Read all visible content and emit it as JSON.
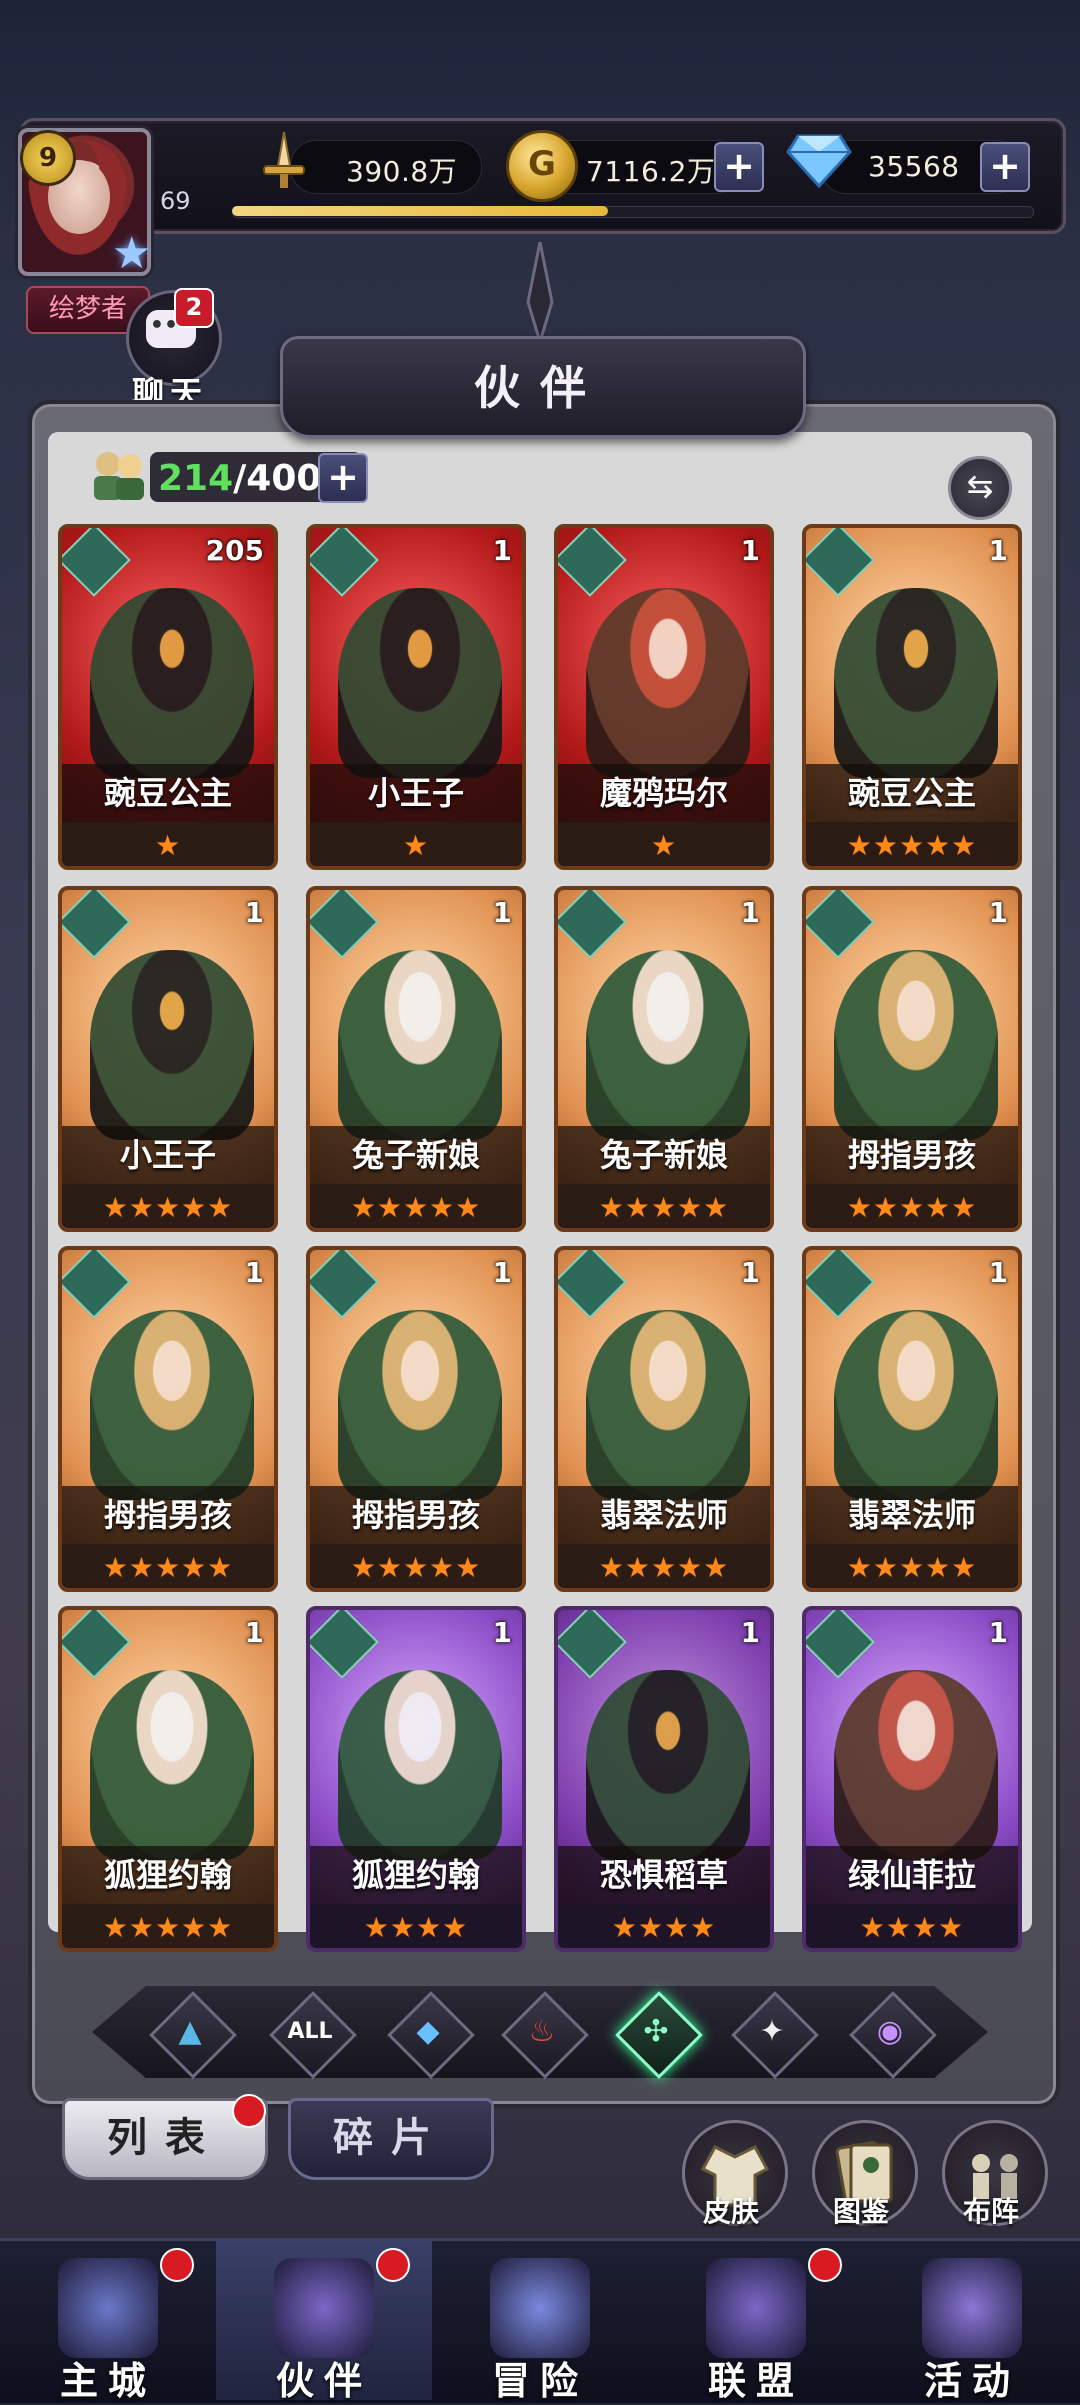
{
  "player": {
    "level": "9",
    "xp_number": "69",
    "xp_progress": 0.47,
    "title_tag": "绘梦者"
  },
  "resources": {
    "power": "390.8万",
    "gold": "7116.2万",
    "gems": "35568",
    "plus": "+"
  },
  "chat": {
    "label": "聊天",
    "badge": "2"
  },
  "page_title": "伙伴",
  "capacity": {
    "current": "214",
    "max": "/400",
    "plus": "+"
  },
  "cards": [
    {
      "name": "豌豆公主",
      "count": "205",
      "stars": "★",
      "style": "red",
      "art": "dark"
    },
    {
      "name": "小王子",
      "count": "1",
      "stars": "★",
      "style": "red",
      "art": "dark"
    },
    {
      "name": "魔鸦玛尔",
      "count": "1",
      "stars": "★",
      "style": "red",
      "art": "ginger"
    },
    {
      "name": "豌豆公主",
      "count": "1",
      "stars": "★★★★★",
      "style": "orange",
      "art": "dark"
    },
    {
      "name": "小王子",
      "count": "1",
      "stars": "★★★★★",
      "style": "orange",
      "art": "dark"
    },
    {
      "name": "兔子新娘",
      "count": "1",
      "stars": "★★★★★",
      "style": "orange",
      "art": "white"
    },
    {
      "name": "兔子新娘",
      "count": "1",
      "stars": "★★★★★",
      "style": "orange",
      "art": "white"
    },
    {
      "name": "拇指男孩",
      "count": "1",
      "stars": "★★★★★",
      "style": "orange",
      "art": "blond"
    },
    {
      "name": "拇指男孩",
      "count": "1",
      "stars": "★★★★★",
      "style": "orange",
      "art": "blond"
    },
    {
      "name": "拇指男孩",
      "count": "1",
      "stars": "★★★★★",
      "style": "orange",
      "art": "blond"
    },
    {
      "name": "翡翠法师",
      "count": "1",
      "stars": "★★★★★",
      "style": "orange",
      "art": "blond"
    },
    {
      "name": "翡翠法师",
      "count": "1",
      "stars": "★★★★★",
      "style": "orange",
      "art": "blond"
    },
    {
      "name": "狐狸约翰",
      "count": "1",
      "stars": "★★★★★",
      "style": "orange",
      "art": "white"
    },
    {
      "name": "狐狸约翰",
      "count": "1",
      "stars": "★★★★",
      "style": "purple",
      "art": "white"
    },
    {
      "name": "恐惧稻草",
      "count": "1",
      "stars": "★★★★",
      "style": "purple2",
      "art": "dark"
    },
    {
      "name": "绿仙菲拉",
      "count": "1",
      "stars": "★★★★",
      "style": "purple",
      "art": "ginger"
    }
  ],
  "filters": [
    {
      "icon": "water-element-icon",
      "glyph": "▲",
      "color": "#5ab8e8"
    },
    {
      "icon": "all-elements-icon",
      "glyph": "ALL",
      "color": "#ffffff"
    },
    {
      "icon": "drop-element-icon",
      "glyph": "◆",
      "color": "#6ac0ff"
    },
    {
      "icon": "fire-element-icon",
      "glyph": "♨",
      "color": "#e84a3a"
    },
    {
      "icon": "wind-element-icon",
      "glyph": "✣",
      "color": "#8affc8",
      "active": true
    },
    {
      "icon": "light-element-icon",
      "glyph": "✦",
      "color": "#f0f0f0"
    },
    {
      "icon": "dark-element-icon",
      "glyph": "◉",
      "color": "#c890ff"
    }
  ],
  "tabs": {
    "list": "列表",
    "fragments": "碎片"
  },
  "side_buttons": {
    "skin": "皮肤",
    "codex": "图鉴",
    "formation": "布阵"
  },
  "nav": [
    {
      "label": "主城",
      "icon": "castle-icon",
      "dot": true
    },
    {
      "label": "伙伴",
      "icon": "witch-hat-icon",
      "dot": true,
      "active": true
    },
    {
      "label": "冒险",
      "icon": "compass-icon",
      "dot": false
    },
    {
      "label": "联盟",
      "icon": "shield-icon",
      "dot": true
    },
    {
      "label": "活动",
      "icon": "cards-icon",
      "dot": false
    }
  ],
  "colors": {
    "accent_green": "#5fe05f",
    "star_orange": "#ff8a1a",
    "badge_red": "#d81a22"
  }
}
